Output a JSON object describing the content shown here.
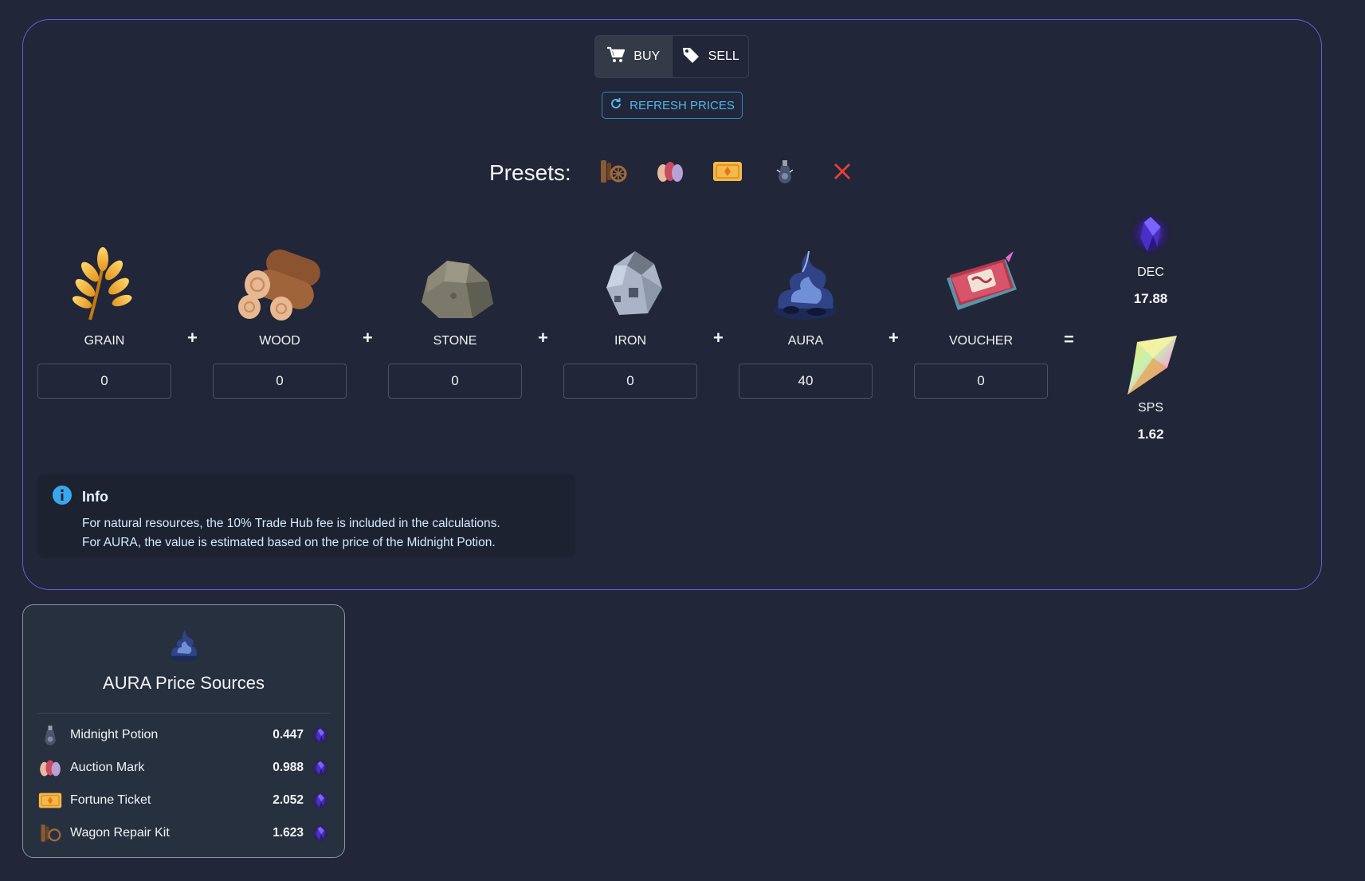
{
  "trade_mode": {
    "buy_label": "BUY",
    "sell_label": "SELL",
    "active": "buy"
  },
  "refresh": {
    "label": "REFRESH PRICES"
  },
  "presets": {
    "label": "Presets:",
    "items": [
      {
        "icon": "wagon-repair-kit-icon"
      },
      {
        "icon": "auction-mark-icon"
      },
      {
        "icon": "fortune-ticket-icon"
      },
      {
        "icon": "midnight-potion-icon"
      },
      {
        "icon": "clear-icon"
      }
    ]
  },
  "resources": [
    {
      "name": "GRAIN",
      "value": "0",
      "icon": "grain-icon"
    },
    {
      "name": "WOOD",
      "value": "0",
      "icon": "wood-icon"
    },
    {
      "name": "STONE",
      "value": "0",
      "icon": "stone-icon"
    },
    {
      "name": "IRON",
      "value": "0",
      "icon": "iron-icon"
    },
    {
      "name": "AURA",
      "value": "40",
      "icon": "aura-icon"
    },
    {
      "name": "VOUCHER",
      "value": "0",
      "icon": "voucher-icon"
    }
  ],
  "operators": {
    "plus": "+",
    "equals": "="
  },
  "outputs": [
    {
      "name": "DEC",
      "value": "17.88",
      "icon": "dec-icon"
    },
    {
      "name": "SPS",
      "value": "1.62",
      "icon": "sps-icon"
    }
  ],
  "info": {
    "title": "Info",
    "line1": "For natural resources, the 10% Trade Hub fee is included in the calculations.",
    "line2": "For AURA, the value is estimated based on the price of the Midnight Potion."
  },
  "aura_sources": {
    "title": "AURA Price Sources",
    "rows": [
      {
        "name": "Midnight Potion",
        "price": "0.447",
        "icon": "midnight-potion-icon"
      },
      {
        "name": "Auction Mark",
        "price": "0.988",
        "icon": "auction-mark-icon"
      },
      {
        "name": "Fortune Ticket",
        "price": "2.052",
        "icon": "fortune-ticket-icon"
      },
      {
        "name": "Wagon Repair Kit",
        "price": "1.623",
        "icon": "wagon-repair-kit-icon"
      }
    ]
  },
  "colors": {
    "background": "#212638",
    "panel_border": "#6b5ce0",
    "accent": "#4fb8ee",
    "clear": "#e5403a"
  }
}
